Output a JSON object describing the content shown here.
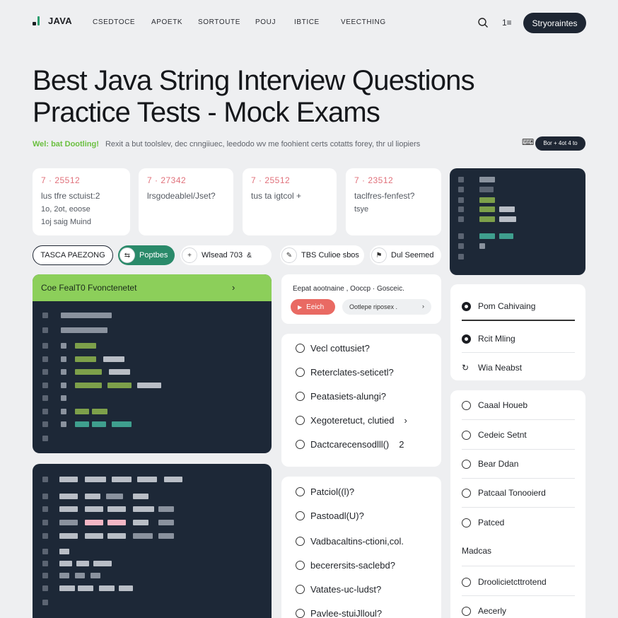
{
  "nav": {
    "logo": "JAVA",
    "links": [
      "CSEDTOCE",
      "APOETK",
      "SORTOUTE",
      "POUJ",
      "IBTICE",
      "VEECTHING"
    ],
    "cta": "Stryoraintes",
    "menu_glyph": "1≡"
  },
  "hero": {
    "title_line1": "Best Java String Interview Questions",
    "title_line2": "Practice Tests - Mock Exams",
    "subtitle_highlight": "Wel: bat Dootling!",
    "subtitle_text": "Rexit a but toolslev, dec cnngiiuec, leedodo wv me foohient certs cotatts forey, thr ul liopiers",
    "side_pill": "Bor + 4ot 4 to"
  },
  "stats": [
    {
      "num": "7 · 25512",
      "lines": [
        "lus tfre sctuist:2",
        "1o, 2ot, eoose",
        "1oj saig Muind"
      ]
    },
    {
      "num": "7 · 27342",
      "lines": [
        "lrsgodeablel/Jset?"
      ]
    },
    {
      "num": "7 · 25512",
      "lines": [
        "tus ta igtcol +"
      ]
    },
    {
      "num": "7 · 23512",
      "lines": [
        "taclfres-fenfest?",
        "tsye"
      ]
    }
  ],
  "filters": [
    {
      "label": "TASCA PAEZONG",
      "style": "outline"
    },
    {
      "label": "Poptbes",
      "style": "active"
    },
    {
      "label": "Wlsead 703",
      "style": "plain"
    },
    {
      "label": "TBS Culioe sbos",
      "style": "plain"
    },
    {
      "label": "Dul Seemed",
      "style": "plain"
    }
  ],
  "code_panel": {
    "title": "Coe FealT0 Fvonctenetet"
  },
  "quiz_header": {
    "label": "Eepat aootnaine , Ooccp · Gosceic.",
    "back": "Eeich",
    "next": "Ootlepe riposex ."
  },
  "quiz_a": [
    "Vecl cottusiet?",
    "Reterclates-seticetl?",
    "Peatasiets-alungi?",
    "Xegoteretuct, clutied",
    "Dactcarecensodlll()"
  ],
  "quiz_a_trailing": [
    "",
    "",
    "",
    "›",
    "2"
  ],
  "quiz_b": [
    "Patciol((l)?",
    "Pastoadl(U)?",
    "Vadbacaltins-ctioni,col.",
    "becerersits-saclebd?",
    "Vatates-uc-ludst?",
    "Pavlee-stuiJlloul?"
  ],
  "side_a": [
    "Pom Cahivaing",
    "Rcit Mling",
    "Wia Neabst"
  ],
  "side_b": [
    "Caaal Houeb",
    "Cedeic Setnt",
    "Bear Ddan",
    "Patcaal Tonooierd",
    "Patced"
  ],
  "side_b_heading": "Madcas",
  "side_b_more": [
    "Droolicietcttrotend",
    "Aecerly"
  ],
  "colors": {
    "accent_green": "#8ccf5a",
    "teal": "#2a8a6a",
    "code_bg": "#1d2837",
    "danger": "#e96a63",
    "dark": "#1e2633"
  },
  "icons": [
    "search-icon",
    "menu-icon",
    "bell-icon",
    "chevron-right-icon",
    "play-icon",
    "leaf-icon"
  ]
}
